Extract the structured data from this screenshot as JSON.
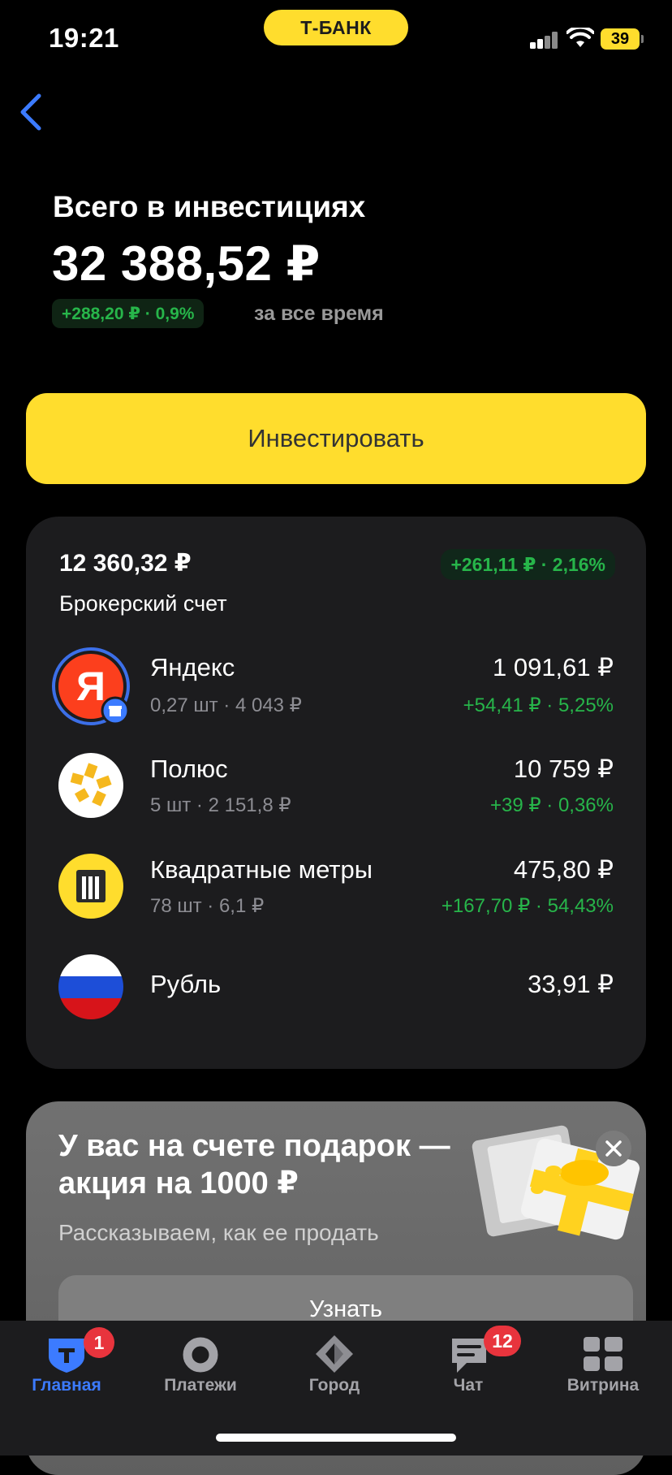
{
  "status_bar": {
    "time": "19:21",
    "bank_label": "Т-БАНК",
    "battery": "39"
  },
  "header": {
    "title": "Всего в инвестициях",
    "total": "32 388,52 ₽",
    "change": "+288,20 ₽ · 0,9%",
    "period": "за все время"
  },
  "invest_button": "Инвестировать",
  "account": {
    "amount": "12 360,32 ₽",
    "name": "Брокерский счет",
    "change": "+261,11 ₽ · 2,16%",
    "positions": [
      {
        "name": "Яндекс",
        "sub": "0,27 шт · 4 043 ₽",
        "value": "1 091,61 ₽",
        "change": "+54,41 ₽ · 5,25%",
        "logo_letter": "Я"
      },
      {
        "name": "Полюс",
        "sub": "5 шт · 2 151,8 ₽",
        "value": "10 759 ₽",
        "change": "+39 ₽ · 0,36%"
      },
      {
        "name": "Квадратные метры",
        "sub": "78 шт · 6,1 ₽",
        "value": "475,80 ₽",
        "change": "+167,70 ₽ · 54,43%"
      },
      {
        "name": "Рубль",
        "value": "33,91 ₽"
      }
    ]
  },
  "promo": {
    "title": "У вас на счете подарок — акция на 1000 ₽",
    "subtitle": "Рассказываем, как ее продать",
    "button": "Узнать"
  },
  "tabbar": {
    "tabs": [
      {
        "label": "Главная",
        "badge": "1",
        "icon": "bank-shield-icon"
      },
      {
        "label": "Платежи",
        "icon": "payments-circle-icon"
      },
      {
        "label": "Город",
        "icon": "city-diamond-icon"
      },
      {
        "label": "Чат",
        "badge": "12",
        "icon": "chat-icon"
      },
      {
        "label": "Витрина",
        "icon": "showcase-grid-icon"
      }
    ]
  },
  "colors": {
    "accent": "#ffdd2d",
    "positive": "#27b54a",
    "active_tab": "#3c7bff",
    "badge": "#e8343d"
  }
}
